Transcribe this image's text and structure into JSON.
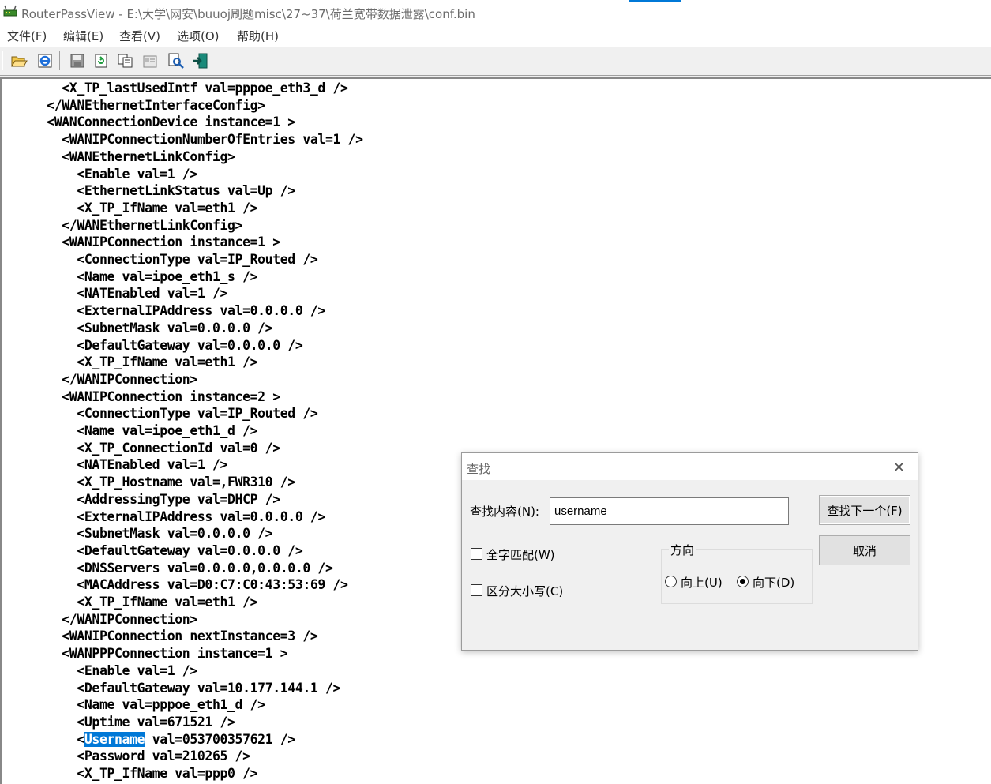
{
  "window": {
    "title": "RouterPassView    -    E:\\大学\\网安\\buuoj刷题misc\\27~37\\荷兰宽带数据泄露\\conf.bin"
  },
  "menu": [
    "文件(F)",
    "编辑(E)",
    "查看(V)",
    "选项(O)",
    "帮助(H)"
  ],
  "toolbar": {
    "buttons": [
      "open-icon",
      "ie-icon",
      "save-icon",
      "refresh-icon",
      "copy-icon",
      "properties-icon",
      "find-icon",
      "exit-icon"
    ]
  },
  "editor": {
    "highlight": "Username",
    "lines": [
      "        <X_TP_lastUsedIntf val=pppoe_eth3_d />",
      "      </WANEthernetInterfaceConfig>",
      "      <WANConnectionDevice instance=1 >",
      "        <WANIPConnectionNumberOfEntries val=1 />",
      "        <WANEthernetLinkConfig>",
      "          <Enable val=1 />",
      "          <EthernetLinkStatus val=Up />",
      "          <X_TP_IfName val=eth1 />",
      "        </WANEthernetLinkConfig>",
      "        <WANIPConnection instance=1 >",
      "          <ConnectionType val=IP_Routed />",
      "          <Name val=ipoe_eth1_s />",
      "          <NATEnabled val=1 />",
      "          <ExternalIPAddress val=0.0.0.0 />",
      "          <SubnetMask val=0.0.0.0 />",
      "          <DefaultGateway val=0.0.0.0 />",
      "          <X_TP_IfName val=eth1 />",
      "        </WANIPConnection>",
      "        <WANIPConnection instance=2 >",
      "          <ConnectionType val=IP_Routed />",
      "          <Name val=ipoe_eth1_d />",
      "          <X_TP_ConnectionId val=0 />",
      "          <NATEnabled val=1 />",
      "          <X_TP_Hostname val=,FWR310 />",
      "          <AddressingType val=DHCP />",
      "          <ExternalIPAddress val=0.0.0.0 />",
      "          <SubnetMask val=0.0.0.0 />",
      "          <DefaultGateway val=0.0.0.0 />",
      "          <DNSServers val=0.0.0.0,0.0.0.0 />",
      "          <MACAddress val=D0:C7:C0:43:53:69 />",
      "          <X_TP_IfName val=eth1 />",
      "        </WANIPConnection>",
      "        <WANIPConnection nextInstance=3 />",
      "        <WANPPPConnection instance=1 >",
      "          <Enable val=1 />",
      "          <DefaultGateway val=10.177.144.1 />",
      "          <Name val=pppoe_eth1_d />",
      "          <Uptime val=671521 />",
      "          <Username val=053700357621 />",
      "          <Password val=210265 />",
      "          <X_TP_IfName val=ppp0 />"
    ]
  },
  "find_dialog": {
    "title": "查找",
    "find_label": "查找内容(N):",
    "find_value": "username",
    "find_next_label": "查找下一个(F)",
    "cancel_label": "取消",
    "whole_word_label": "全字匹配(W)",
    "whole_word_checked": false,
    "match_case_label": "区分大小写(C)",
    "match_case_checked": false,
    "direction_label": "方向",
    "up_label": "向上(U)",
    "down_label": "向下(D)",
    "direction_selected": "down"
  },
  "colors": {
    "selection": "#0078d7",
    "title_accent": "#0078d7"
  }
}
